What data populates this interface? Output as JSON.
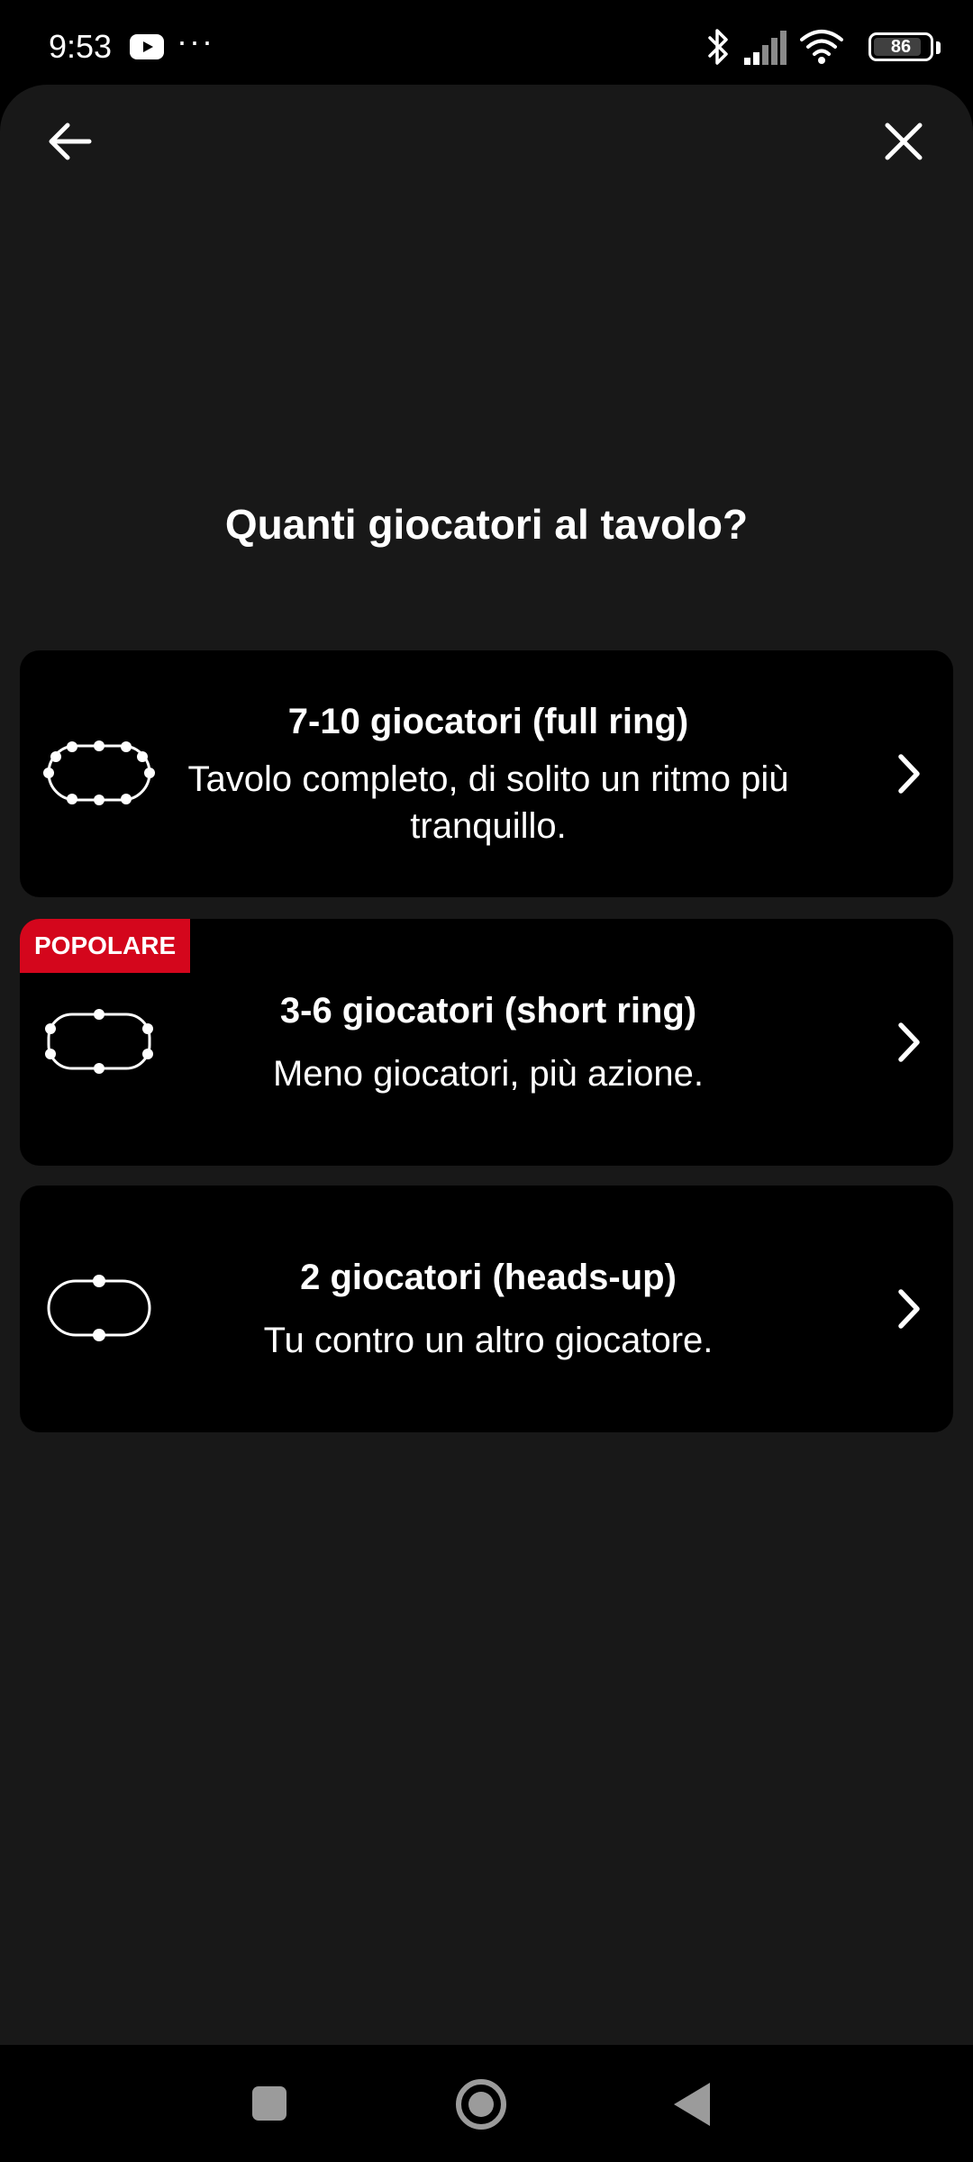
{
  "status_bar": {
    "time": "9:53",
    "notification_icons": [
      "youtube-icon",
      "more-dots-icon"
    ],
    "dots": "···",
    "system_icons": [
      "bluetooth-icon",
      "signal-icon",
      "wifi-icon",
      "battery-icon"
    ],
    "battery_level": "86"
  },
  "header": {
    "back_icon": "arrow-left-icon",
    "close_icon": "close-icon"
  },
  "question": "Quanti giocatori al tavolo?",
  "options": [
    {
      "title": "7-10 giocatori (full ring)",
      "description": "Tavolo completo, di solito un ritmo più tranquillo.",
      "icon": "full-ring-table-icon",
      "badge": ""
    },
    {
      "title": "3-6 giocatori (short ring)",
      "description": "Meno giocatori, più azione.",
      "icon": "short-ring-table-icon",
      "badge": "POPOLARE"
    },
    {
      "title": "2 giocatori (heads-up)",
      "description": "Tu contro un altro giocatore.",
      "icon": "heads-up-table-icon",
      "badge": ""
    }
  ],
  "colors": {
    "sheet_background": "#181818",
    "card_background": "#000000",
    "badge_background": "#d4061c",
    "text": "#ffffff",
    "nav_icons": "#9b9b9b"
  },
  "bottom_nav": {
    "icons": [
      "recents-square-icon",
      "home-circle-icon",
      "back-triangle-icon"
    ]
  }
}
